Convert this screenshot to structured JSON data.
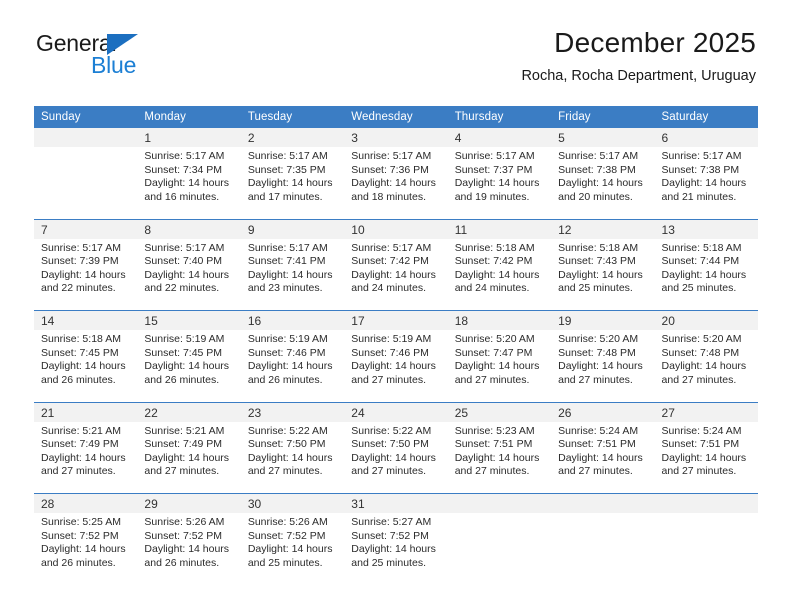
{
  "brand": {
    "name_line1": "General",
    "name_line2": "Blue",
    "triangle_color": "#1c6fc0",
    "blue_color": "#1c7fd4"
  },
  "header": {
    "title": "December 2025",
    "subtitle": "Rocha, Rocha Department, Uruguay"
  },
  "theme": {
    "header_blue": "#3b7dc4",
    "daynum_bg": "#f2f2f2",
    "cell_bg": "#ffffff"
  },
  "weekday_headers": [
    "Sunday",
    "Monday",
    "Tuesday",
    "Wednesday",
    "Thursday",
    "Friday",
    "Saturday"
  ],
  "weeks": [
    {
      "days": [
        {
          "num": "",
          "sunrise": "",
          "sunset": "",
          "daylight1": "",
          "daylight2": "",
          "empty": true
        },
        {
          "num": "1",
          "sunrise": "Sunrise: 5:17 AM",
          "sunset": "Sunset: 7:34 PM",
          "daylight1": "Daylight: 14 hours",
          "daylight2": "and 16 minutes."
        },
        {
          "num": "2",
          "sunrise": "Sunrise: 5:17 AM",
          "sunset": "Sunset: 7:35 PM",
          "daylight1": "Daylight: 14 hours",
          "daylight2": "and 17 minutes."
        },
        {
          "num": "3",
          "sunrise": "Sunrise: 5:17 AM",
          "sunset": "Sunset: 7:36 PM",
          "daylight1": "Daylight: 14 hours",
          "daylight2": "and 18 minutes."
        },
        {
          "num": "4",
          "sunrise": "Sunrise: 5:17 AM",
          "sunset": "Sunset: 7:37 PM",
          "daylight1": "Daylight: 14 hours",
          "daylight2": "and 19 minutes."
        },
        {
          "num": "5",
          "sunrise": "Sunrise: 5:17 AM",
          "sunset": "Sunset: 7:38 PM",
          "daylight1": "Daylight: 14 hours",
          "daylight2": "and 20 minutes."
        },
        {
          "num": "6",
          "sunrise": "Sunrise: 5:17 AM",
          "sunset": "Sunset: 7:38 PM",
          "daylight1": "Daylight: 14 hours",
          "daylight2": "and 21 minutes."
        }
      ]
    },
    {
      "days": [
        {
          "num": "7",
          "sunrise": "Sunrise: 5:17 AM",
          "sunset": "Sunset: 7:39 PM",
          "daylight1": "Daylight: 14 hours",
          "daylight2": "and 22 minutes."
        },
        {
          "num": "8",
          "sunrise": "Sunrise: 5:17 AM",
          "sunset": "Sunset: 7:40 PM",
          "daylight1": "Daylight: 14 hours",
          "daylight2": "and 22 minutes."
        },
        {
          "num": "9",
          "sunrise": "Sunrise: 5:17 AM",
          "sunset": "Sunset: 7:41 PM",
          "daylight1": "Daylight: 14 hours",
          "daylight2": "and 23 minutes."
        },
        {
          "num": "10",
          "sunrise": "Sunrise: 5:17 AM",
          "sunset": "Sunset: 7:42 PM",
          "daylight1": "Daylight: 14 hours",
          "daylight2": "and 24 minutes."
        },
        {
          "num": "11",
          "sunrise": "Sunrise: 5:18 AM",
          "sunset": "Sunset: 7:42 PM",
          "daylight1": "Daylight: 14 hours",
          "daylight2": "and 24 minutes."
        },
        {
          "num": "12",
          "sunrise": "Sunrise: 5:18 AM",
          "sunset": "Sunset: 7:43 PM",
          "daylight1": "Daylight: 14 hours",
          "daylight2": "and 25 minutes."
        },
        {
          "num": "13",
          "sunrise": "Sunrise: 5:18 AM",
          "sunset": "Sunset: 7:44 PM",
          "daylight1": "Daylight: 14 hours",
          "daylight2": "and 25 minutes."
        }
      ]
    },
    {
      "days": [
        {
          "num": "14",
          "sunrise": "Sunrise: 5:18 AM",
          "sunset": "Sunset: 7:45 PM",
          "daylight1": "Daylight: 14 hours",
          "daylight2": "and 26 minutes."
        },
        {
          "num": "15",
          "sunrise": "Sunrise: 5:19 AM",
          "sunset": "Sunset: 7:45 PM",
          "daylight1": "Daylight: 14 hours",
          "daylight2": "and 26 minutes."
        },
        {
          "num": "16",
          "sunrise": "Sunrise: 5:19 AM",
          "sunset": "Sunset: 7:46 PM",
          "daylight1": "Daylight: 14 hours",
          "daylight2": "and 26 minutes."
        },
        {
          "num": "17",
          "sunrise": "Sunrise: 5:19 AM",
          "sunset": "Sunset: 7:46 PM",
          "daylight1": "Daylight: 14 hours",
          "daylight2": "and 27 minutes."
        },
        {
          "num": "18",
          "sunrise": "Sunrise: 5:20 AM",
          "sunset": "Sunset: 7:47 PM",
          "daylight1": "Daylight: 14 hours",
          "daylight2": "and 27 minutes."
        },
        {
          "num": "19",
          "sunrise": "Sunrise: 5:20 AM",
          "sunset": "Sunset: 7:48 PM",
          "daylight1": "Daylight: 14 hours",
          "daylight2": "and 27 minutes."
        },
        {
          "num": "20",
          "sunrise": "Sunrise: 5:20 AM",
          "sunset": "Sunset: 7:48 PM",
          "daylight1": "Daylight: 14 hours",
          "daylight2": "and 27 minutes."
        }
      ]
    },
    {
      "days": [
        {
          "num": "21",
          "sunrise": "Sunrise: 5:21 AM",
          "sunset": "Sunset: 7:49 PM",
          "daylight1": "Daylight: 14 hours",
          "daylight2": "and 27 minutes."
        },
        {
          "num": "22",
          "sunrise": "Sunrise: 5:21 AM",
          "sunset": "Sunset: 7:49 PM",
          "daylight1": "Daylight: 14 hours",
          "daylight2": "and 27 minutes."
        },
        {
          "num": "23",
          "sunrise": "Sunrise: 5:22 AM",
          "sunset": "Sunset: 7:50 PM",
          "daylight1": "Daylight: 14 hours",
          "daylight2": "and 27 minutes."
        },
        {
          "num": "24",
          "sunrise": "Sunrise: 5:22 AM",
          "sunset": "Sunset: 7:50 PM",
          "daylight1": "Daylight: 14 hours",
          "daylight2": "and 27 minutes."
        },
        {
          "num": "25",
          "sunrise": "Sunrise: 5:23 AM",
          "sunset": "Sunset: 7:51 PM",
          "daylight1": "Daylight: 14 hours",
          "daylight2": "and 27 minutes."
        },
        {
          "num": "26",
          "sunrise": "Sunrise: 5:24 AM",
          "sunset": "Sunset: 7:51 PM",
          "daylight1": "Daylight: 14 hours",
          "daylight2": "and 27 minutes."
        },
        {
          "num": "27",
          "sunrise": "Sunrise: 5:24 AM",
          "sunset": "Sunset: 7:51 PM",
          "daylight1": "Daylight: 14 hours",
          "daylight2": "and 27 minutes."
        }
      ]
    },
    {
      "days": [
        {
          "num": "28",
          "sunrise": "Sunrise: 5:25 AM",
          "sunset": "Sunset: 7:52 PM",
          "daylight1": "Daylight: 14 hours",
          "daylight2": "and 26 minutes."
        },
        {
          "num": "29",
          "sunrise": "Sunrise: 5:26 AM",
          "sunset": "Sunset: 7:52 PM",
          "daylight1": "Daylight: 14 hours",
          "daylight2": "and 26 minutes."
        },
        {
          "num": "30",
          "sunrise": "Sunrise: 5:26 AM",
          "sunset": "Sunset: 7:52 PM",
          "daylight1": "Daylight: 14 hours",
          "daylight2": "and 25 minutes."
        },
        {
          "num": "31",
          "sunrise": "Sunrise: 5:27 AM",
          "sunset": "Sunset: 7:52 PM",
          "daylight1": "Daylight: 14 hours",
          "daylight2": "and 25 minutes."
        },
        {
          "num": "",
          "sunrise": "",
          "sunset": "",
          "daylight1": "",
          "daylight2": "",
          "empty": true
        },
        {
          "num": "",
          "sunrise": "",
          "sunset": "",
          "daylight1": "",
          "daylight2": "",
          "empty": true
        },
        {
          "num": "",
          "sunrise": "",
          "sunset": "",
          "daylight1": "",
          "daylight2": "",
          "empty": true
        }
      ]
    }
  ]
}
